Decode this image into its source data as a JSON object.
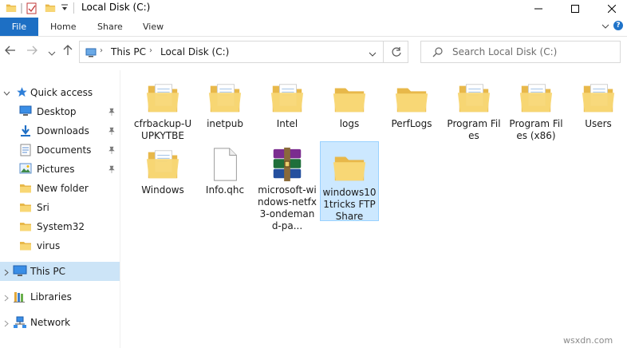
{
  "window": {
    "title": "Local Disk (C:)"
  },
  "ribbon": {
    "tabs": [
      "File",
      "Home",
      "Share",
      "View"
    ],
    "help": "?"
  },
  "address": {
    "crumbs": [
      "This PC",
      "Local Disk (C:)"
    ]
  },
  "search": {
    "placeholder": "Search Local Disk (C:)"
  },
  "sidebar": {
    "quick_access": "Quick access",
    "items": [
      {
        "label": "Desktop",
        "icon": "desktop-icon",
        "pinned": true
      },
      {
        "label": "Downloads",
        "icon": "download-icon",
        "pinned": true
      },
      {
        "label": "Documents",
        "icon": "documents-icon",
        "pinned": true
      },
      {
        "label": "Pictures",
        "icon": "pictures-icon",
        "pinned": true
      },
      {
        "label": "New folder",
        "icon": "folder-icon",
        "pinned": false
      },
      {
        "label": "Sri",
        "icon": "folder-icon",
        "pinned": false
      },
      {
        "label": "System32",
        "icon": "folder-icon",
        "pinned": false
      },
      {
        "label": "virus",
        "icon": "folder-icon",
        "pinned": false
      }
    ],
    "this_pc": "This PC",
    "libraries": "Libraries",
    "network": "Network"
  },
  "files": [
    {
      "name": "cfrbackup-UUPKYTBE",
      "icon": "folder-docs-icon"
    },
    {
      "name": "inetpub",
      "icon": "folder-docs-icon"
    },
    {
      "name": "Intel",
      "icon": "folder-docs-icon"
    },
    {
      "name": "logs",
      "icon": "folder-icon"
    },
    {
      "name": "PerfLogs",
      "icon": "folder-icon"
    },
    {
      "name": "Program Files",
      "icon": "folder-docs-icon"
    },
    {
      "name": "Program Files (x86)",
      "icon": "folder-docs-icon"
    },
    {
      "name": "Users",
      "icon": "folder-docs-icon"
    },
    {
      "name": "Windows",
      "icon": "folder-docs-icon"
    },
    {
      "name": "Info.qhc",
      "icon": "file-icon"
    },
    {
      "name": "microsoft-windows-netfx3-ondemand-pa...",
      "icon": "winrar-archive-icon"
    },
    {
      "name": "windows101tricks FTP Share",
      "icon": "folder-icon",
      "selected": true
    }
  ],
  "colors": {
    "accent": "#1d6fc4",
    "selection": "#cce8ff",
    "folder": "#f8d775"
  },
  "watermark": "wsxdn.com"
}
